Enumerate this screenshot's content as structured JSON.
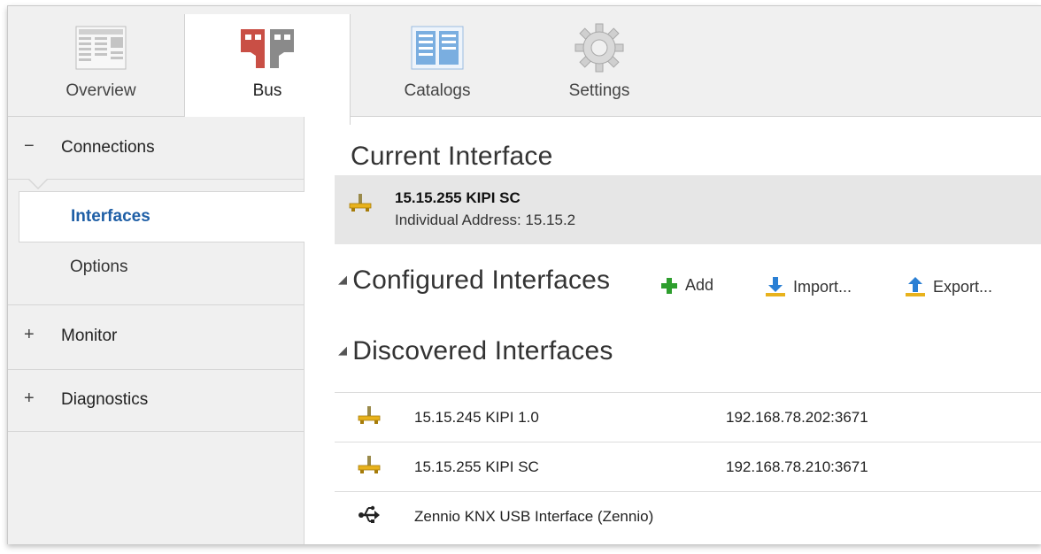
{
  "ribbon": {
    "tabs": [
      {
        "label": "Overview"
      },
      {
        "label": "Bus"
      },
      {
        "label": "Catalogs"
      },
      {
        "label": "Settings"
      }
    ]
  },
  "sidebar": {
    "groups": [
      {
        "label": "Connections",
        "sign": "−"
      },
      {
        "label": "Monitor",
        "sign": "+"
      },
      {
        "label": "Diagnostics",
        "sign": "+"
      }
    ],
    "subitems": [
      {
        "label": "Interfaces"
      },
      {
        "label": "Options"
      }
    ]
  },
  "main": {
    "current_title": "Current Interface",
    "current": {
      "name": "15.15.255 KIPI SC",
      "address": "Individual Address: 15.15.2"
    },
    "configured_title": "Configured Interfaces",
    "actions": {
      "add": "Add",
      "import": "Import...",
      "export": "Export..."
    },
    "discovered_title": "Discovered Interfaces",
    "discovered": [
      {
        "name": "15.15.245 KIPI 1.0",
        "address": "192.168.78.202:3671",
        "icon": "network-icon"
      },
      {
        "name": "15.15.255 KIPI SC",
        "address": "192.168.78.210:3671",
        "icon": "network-icon"
      },
      {
        "name": "Zennio KNX USB Interface (Zennio)",
        "address": "",
        "icon": "usb-icon"
      }
    ]
  },
  "colors": {
    "accent": "#1f5fa6",
    "add_green": "#2e9e2e",
    "download_blue": "#2a7fd4",
    "network_yellow": "#e8b21c"
  }
}
